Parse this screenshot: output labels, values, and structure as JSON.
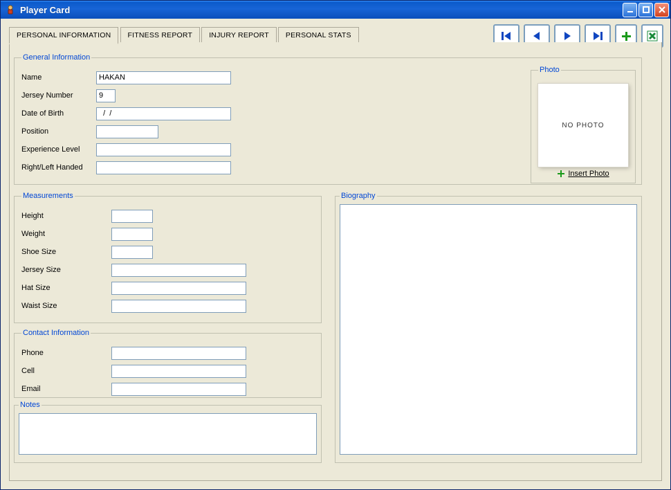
{
  "window": {
    "title": "Player Card"
  },
  "toolbar": {
    "first": "first-button",
    "prev": "prev-button",
    "next": "next-button",
    "last": "last-button",
    "add": "add-button",
    "export": "export-excel-button"
  },
  "tabs": [
    {
      "label": "PERSONAL INFORMATION",
      "active": true
    },
    {
      "label": "FITNESS REPORT",
      "active": false
    },
    {
      "label": "INJURY REPORT",
      "active": false
    },
    {
      "label": "PERSONAL STATS",
      "active": false
    }
  ],
  "general_info": {
    "legend": "General Information",
    "name_label": "Name",
    "name_value": "HAKAN",
    "jersey_label": "Jersey Number",
    "jersey_value": "9",
    "dob_label": "Date of Birth",
    "dob_value": "  /  /",
    "position_label": "Position",
    "position_value": "",
    "experience_label": "Experience Level",
    "experience_value": "",
    "hand_label": "Right/Left Handed",
    "hand_value": ""
  },
  "photo": {
    "legend": "Photo",
    "placeholder": "NO PHOTO",
    "insert_label": "Insert Photo"
  },
  "measurements": {
    "legend": "Measurements",
    "height_label": "Height",
    "height_value": "",
    "weight_label": "Weight",
    "weight_value": "",
    "shoe_label": "Shoe Size",
    "shoe_value": "",
    "jersey_size_label": "Jersey Size",
    "jersey_size_value": "",
    "hat_label": "Hat Size",
    "hat_value": "",
    "waist_label": "Waist Size",
    "waist_value": ""
  },
  "contact": {
    "legend": "Contact Information",
    "phone_label": "Phone",
    "phone_value": "",
    "cell_label": "Cell",
    "cell_value": "",
    "email_label": "Email",
    "email_value": ""
  },
  "notes": {
    "legend": "Notes",
    "value": ""
  },
  "biography": {
    "legend": "Biography",
    "value": ""
  }
}
